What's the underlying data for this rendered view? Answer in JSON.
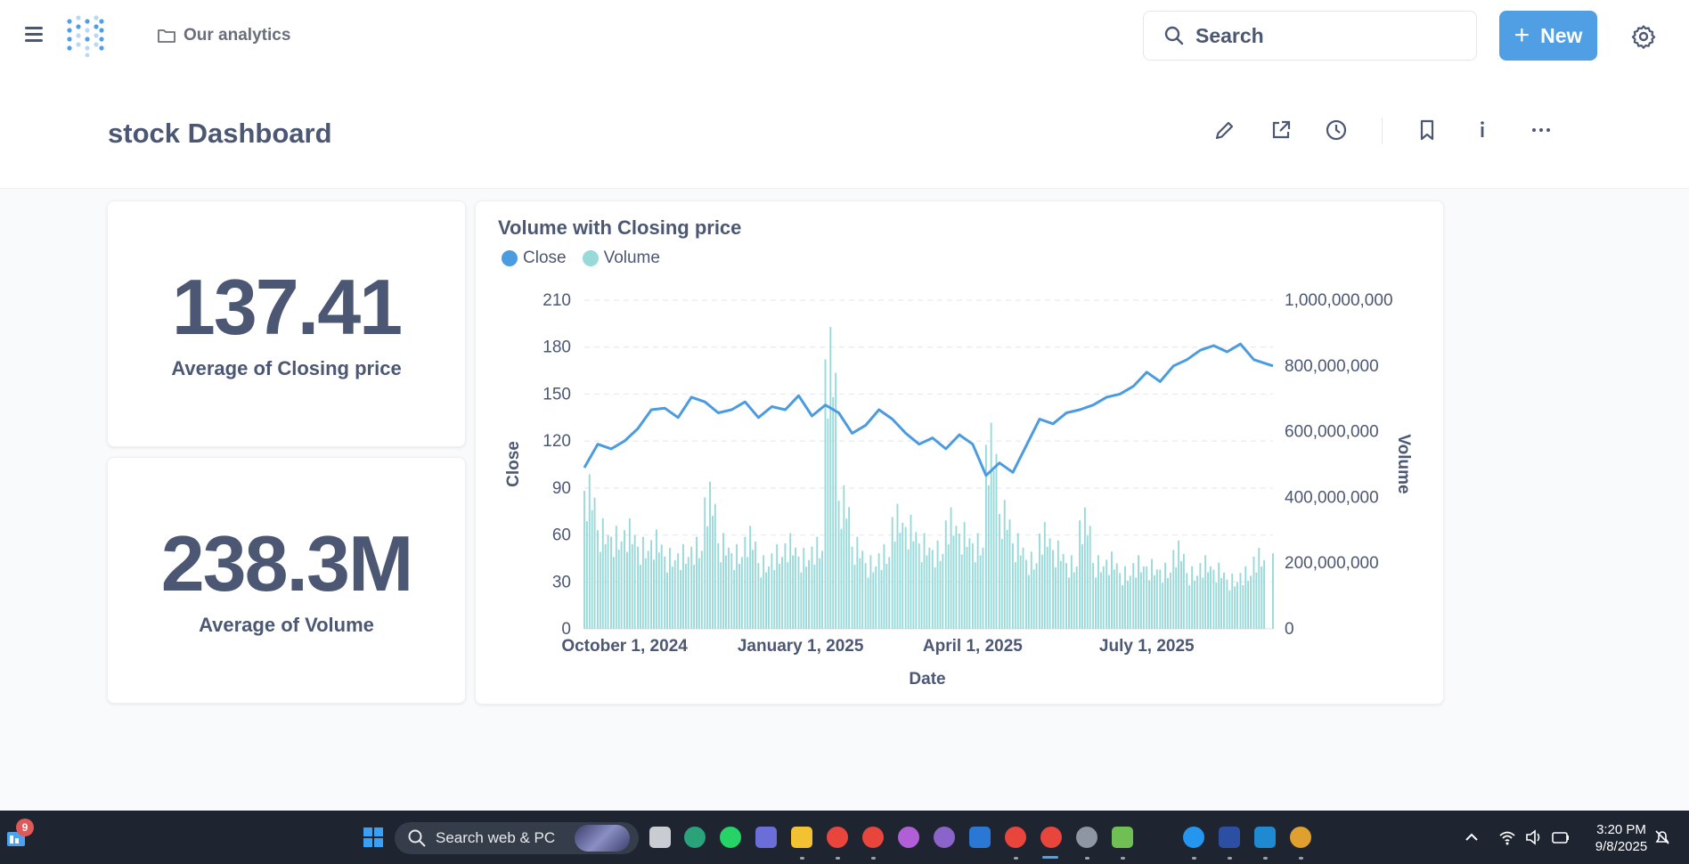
{
  "topbar": {
    "breadcrumb": "Our analytics",
    "search_label": "Search",
    "new_label": "New"
  },
  "header": {
    "title": "stock Dashboard"
  },
  "colors": {
    "brand": "#509ee3",
    "text": "#4c5773",
    "close_series": "#4b9be0",
    "volume_series": "#98d9d9"
  },
  "cards": {
    "avg_close": {
      "value": "137.41",
      "label": "Average of Closing price"
    },
    "avg_volume": {
      "value": "238.3M",
      "label": "Average of Volume"
    }
  },
  "chart_data": {
    "type": "line",
    "title": "Volume with Closing price",
    "xlabel": "Date",
    "ylabel": "Close",
    "y2label": "Volume",
    "legend": [
      "Close",
      "Volume"
    ],
    "legend_position": "top-left",
    "x_ticks": [
      "October 1, 2024",
      "January 1, 2025",
      "April 1, 2025",
      "July 1, 2025"
    ],
    "x_range": [
      "2024-09-10",
      "2025-09-05"
    ],
    "y_ticks": [
      0,
      30,
      60,
      90,
      120,
      150,
      180,
      210
    ],
    "ylim": [
      0,
      210
    ],
    "y2_ticks": [
      "0",
      "200,000,000",
      "400,000,000",
      "600,000,000",
      "800,000,000",
      "1,000,000,000"
    ],
    "y2lim": [
      0,
      1000000000
    ],
    "grid": true,
    "series": [
      {
        "name": "Close",
        "type": "line",
        "x": [
          "2024-09-10",
          "2024-09-17",
          "2024-09-24",
          "2024-10-01",
          "2024-10-08",
          "2024-10-15",
          "2024-10-22",
          "2024-10-29",
          "2024-11-05",
          "2024-11-12",
          "2024-11-19",
          "2024-11-26",
          "2024-12-03",
          "2024-12-10",
          "2024-12-17",
          "2024-12-24",
          "2024-12-31",
          "2025-01-07",
          "2025-01-14",
          "2025-01-21",
          "2025-01-28",
          "2025-02-04",
          "2025-02-11",
          "2025-02-18",
          "2025-02-25",
          "2025-03-04",
          "2025-03-11",
          "2025-03-18",
          "2025-03-25",
          "2025-04-01",
          "2025-04-08",
          "2025-04-15",
          "2025-04-22",
          "2025-04-29",
          "2025-05-06",
          "2025-05-13",
          "2025-05-20",
          "2025-05-27",
          "2025-06-03",
          "2025-06-10",
          "2025-06-17",
          "2025-06-24",
          "2025-07-01",
          "2025-07-08",
          "2025-07-15",
          "2025-07-22",
          "2025-07-29",
          "2025-08-05",
          "2025-08-12",
          "2025-08-19",
          "2025-08-26",
          "2025-09-05"
        ],
        "values": [
          103,
          118,
          115,
          120,
          128,
          140,
          141,
          135,
          148,
          145,
          138,
          140,
          145,
          135,
          142,
          140,
          149,
          136,
          143,
          138,
          125,
          130,
          140,
          134,
          125,
          118,
          122,
          115,
          124,
          118,
          98,
          106,
          100,
          117,
          134,
          131,
          138,
          140,
          143,
          148,
          150,
          155,
          164,
          158,
          168,
          172,
          178,
          181,
          177,
          182,
          172,
          168
        ]
      },
      {
        "name": "Volume",
        "type": "bar",
        "x": [
          "2024-09-10",
          "2024-09-17",
          "2024-09-24",
          "2024-10-01",
          "2024-10-08",
          "2024-10-15",
          "2024-10-22",
          "2024-10-29",
          "2024-11-05",
          "2024-11-12",
          "2024-11-19",
          "2024-11-26",
          "2024-12-03",
          "2024-12-10",
          "2024-12-17",
          "2024-12-24",
          "2024-12-31",
          "2025-01-07",
          "2025-01-14",
          "2025-01-21",
          "2025-01-28",
          "2025-02-04",
          "2025-02-11",
          "2025-02-18",
          "2025-02-25",
          "2025-03-04",
          "2025-03-11",
          "2025-03-18",
          "2025-03-25",
          "2025-04-01",
          "2025-04-08",
          "2025-04-15",
          "2025-04-22",
          "2025-04-29",
          "2025-05-06",
          "2025-05-13",
          "2025-05-20",
          "2025-05-27",
          "2025-06-03",
          "2025-06-10",
          "2025-06-17",
          "2025-06-24",
          "2025-07-01",
          "2025-07-08",
          "2025-07-15",
          "2025-07-22",
          "2025-07-29",
          "2025-08-05",
          "2025-08-12",
          "2025-08-19",
          "2025-08-26",
          "2025-09-05"
        ],
        "values": [
          420000000,
          300000000,
          280000000,
          300000000,
          250000000,
          270000000,
          220000000,
          230000000,
          250000000,
          400000000,
          260000000,
          230000000,
          280000000,
          200000000,
          230000000,
          260000000,
          220000000,
          250000000,
          820000000,
          390000000,
          250000000,
          200000000,
          230000000,
          340000000,
          310000000,
          260000000,
          240000000,
          330000000,
          290000000,
          260000000,
          560000000,
          350000000,
          260000000,
          210000000,
          290000000,
          240000000,
          200000000,
          330000000,
          200000000,
          210000000,
          170000000,
          200000000,
          190000000,
          180000000,
          240000000,
          170000000,
          200000000,
          180000000,
          150000000,
          170000000,
          220000000,
          230000000
        ]
      }
    ]
  },
  "taskbar": {
    "badge": "9",
    "search_placeholder": "Search web & PC",
    "time": "3:20 PM",
    "date": "9/8/2025"
  }
}
